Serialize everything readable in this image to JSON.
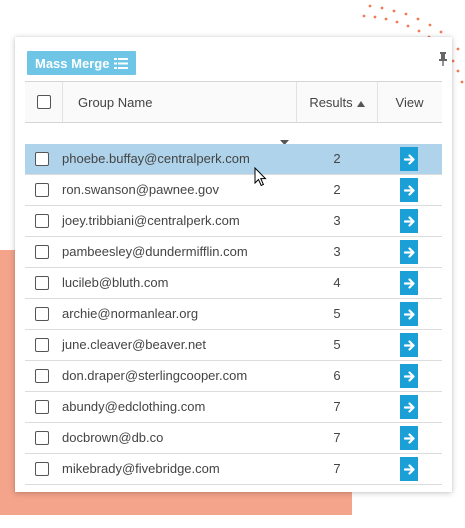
{
  "toolbar": {
    "mass_merge_label": "Mass Merge",
    "mass_merge_icon": "list-icon",
    "pin_icon": "pin-icon"
  },
  "table": {
    "columns": {
      "group_name": "Group Name",
      "results": "Results",
      "view": "View"
    },
    "sort": {
      "column": "results",
      "direction": "ascending"
    },
    "rows": [
      {
        "email": "phoebe.buffay@centralperk.com",
        "results": "2",
        "selected": true
      },
      {
        "email": "ron.swanson@pawnee.gov",
        "results": "2"
      },
      {
        "email": "joey.tribbiani@centralperk.com",
        "results": "3"
      },
      {
        "email": "pambeesley@dundermifflin.com",
        "results": "3"
      },
      {
        "email": "lucileb@bluth.com",
        "results": "4"
      },
      {
        "email": "archie@normanlear.org",
        "results": "5"
      },
      {
        "email": "june.cleaver@beaver.net",
        "results": "5"
      },
      {
        "email": "don.draper@sterlingcooper.com",
        "results": "6"
      },
      {
        "email": "abundy@edclothing.com",
        "results": "7"
      },
      {
        "email": "docbrown@db.co",
        "results": "7"
      },
      {
        "email": "mikebrady@fivebridge.com",
        "results": "7"
      }
    ]
  },
  "colors": {
    "accent_button": "#6ec5e5",
    "view_button": "#1a9fd6",
    "selected_row": "#aed3ea",
    "background_block": "#f3a48a",
    "dots": "#f07b54"
  }
}
